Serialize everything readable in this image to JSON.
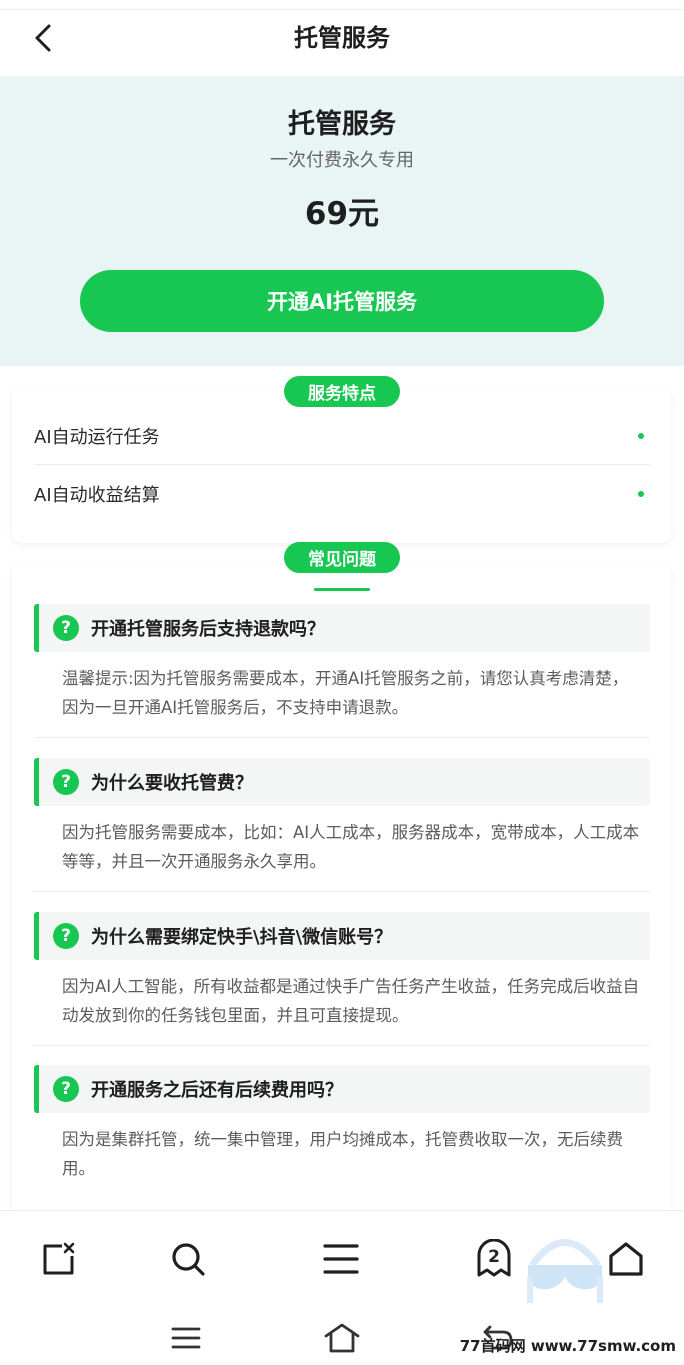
{
  "header": {
    "title": "托管服务"
  },
  "hero": {
    "title": "托管服务",
    "subtitle": "一次付费永久专用",
    "price": "69元",
    "cta_label": "开通AI托管服务"
  },
  "features": {
    "badge": "服务特点",
    "items": [
      {
        "label": "AI自动运行任务"
      },
      {
        "label": "AI自动收益结算"
      }
    ]
  },
  "faq": {
    "badge": "常见问题",
    "items": [
      {
        "question": "开通托管服务后支持退款吗？",
        "answer": "温馨提示:因为托管服务需要成本，开通AI托管服务之前，请您认真考虑清楚，因为一旦开通AI托管服务后，不支持申请退款。"
      },
      {
        "question": "为什么要收托管费？",
        "answer": "因为托管服务需要成本，比如：AI人工成本，服务器成本，宽带成本，人工成本等等，并且一次开通服务永久享用。"
      },
      {
        "question": "为什么需要绑定快手\\抖音\\微信账号？",
        "answer": "因为AI人工智能，所有收益都是通过快手广告任务产生收益，任务完成后收益自动发放到你的任务钱包里面，并且可直接提现。"
      },
      {
        "question": "开通服务之后还有后续费用吗？",
        "answer": "因为是集群托管，统一集中管理，用户均摊成本，托管费收取一次，无后续费用。"
      }
    ]
  },
  "browser_bar": {
    "tab_count": "2"
  },
  "watermark": "77首码网 www.77smw.com",
  "colors": {
    "accent": "#17c752",
    "hero_bg": "#e9f4f4"
  }
}
